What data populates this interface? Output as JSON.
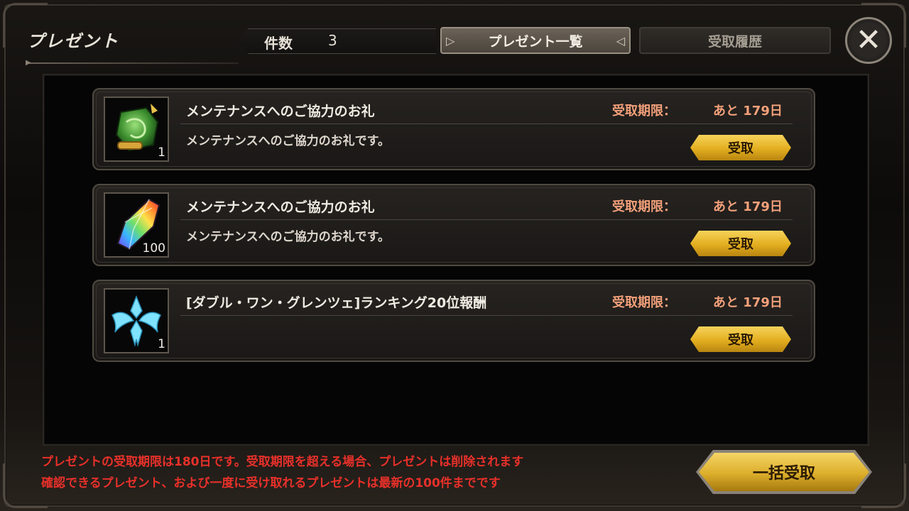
{
  "screen": {
    "title": "プレゼント",
    "count_label": "件数",
    "count_value": "3"
  },
  "tabs": [
    {
      "label": "プレゼント一覧",
      "active": true
    },
    {
      "label": "受取履歴",
      "active": false
    }
  ],
  "close_icon": "close-icon",
  "items": [
    {
      "icon": "green-scroll-icon",
      "quantity": "1",
      "title": "メンテナンスへのご協力のお礼",
      "description": "メンテナンスへのご協力のお礼です。",
      "deadline_label": "受取期限：",
      "deadline_value": "あと 179日",
      "claim_label": "受取"
    },
    {
      "icon": "rainbow-crystal-icon",
      "quantity": "100",
      "title": "メンテナンスへのご協力のお礼",
      "description": "メンテナンスへのご協力のお礼です。",
      "deadline_label": "受取期限：",
      "deadline_value": "あと 179日",
      "claim_label": "受取"
    },
    {
      "icon": "blue-emblem-icon",
      "quantity": "1",
      "title": "[ダブル・ワン・グレンツェ]ランキング20位報酬",
      "description": "",
      "deadline_label": "受取期限：",
      "deadline_value": "あと 179日",
      "claim_label": "受取"
    }
  ],
  "notice": {
    "line1": "プレゼントの受取期限は180日です。受取期限を超える場合、プレゼントは削除されます",
    "line2": "確認できるプレゼント、および一度に受け取れるプレゼントは最新の100件までです"
  },
  "bulk_claim_label": "一括受取",
  "colors": {
    "accent_gold": "#e3ae1f",
    "deadline_text": "#f2a07a",
    "notice_text": "#e8302a"
  }
}
